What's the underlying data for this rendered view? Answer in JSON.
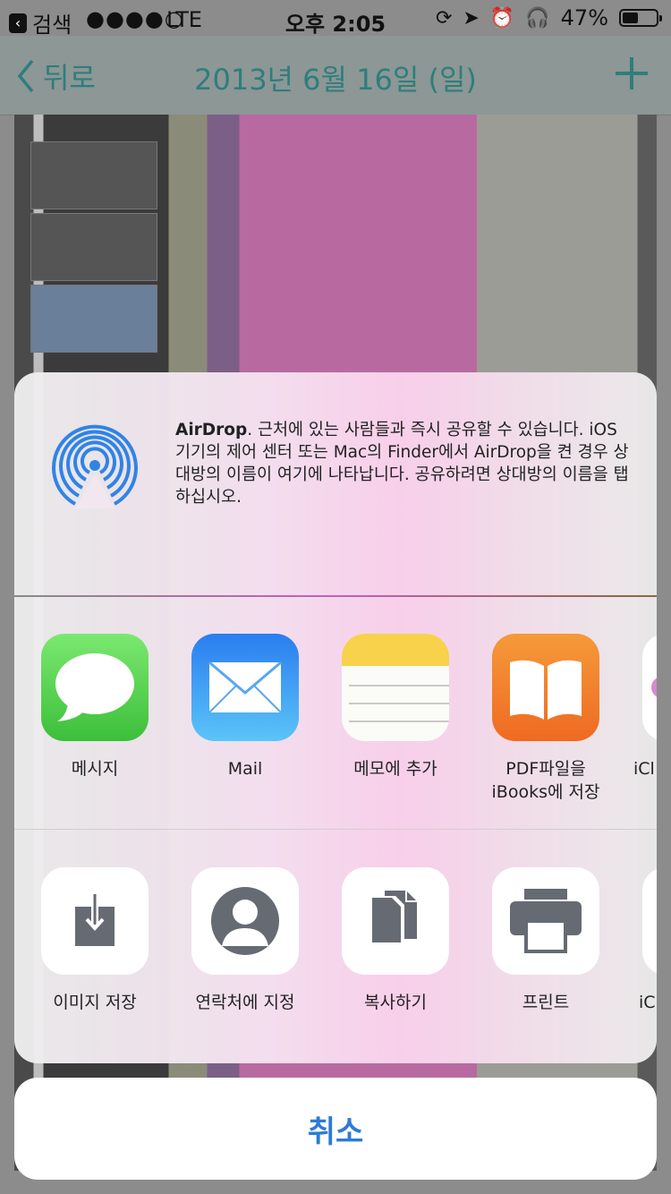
{
  "status_bar": {
    "back_app": "검색",
    "signal": "●●●●○",
    "carrier": "LTE",
    "time": "오후 2:05",
    "battery": "47%",
    "battery_level": 0.47
  },
  "nav": {
    "back_label": "뒤로",
    "title": "2013년 6월 16일 (일)"
  },
  "airdrop": {
    "title": "AirDrop",
    "text": ". 근처에 있는 사람들과 즉시 공유할 수 있습니다. iOS 기기의 제어 센터 또는 Mac의 Finder에서 AirDrop을 켠 경우 상대방의 이름이 여기에 나타납니다. 공유하려면 상대방의 이름을 탭하십시오."
  },
  "apps": [
    {
      "label": "메시지",
      "icon": "messages-icon"
    },
    {
      "label": "Mail",
      "icon": "mail-icon"
    },
    {
      "label": "메모에 추가",
      "icon": "notes-icon"
    },
    {
      "label": "PDF파일을\niBooks에 저장",
      "icon": "ibooks-icon"
    },
    {
      "label": "iCl",
      "icon": "icloud-icon"
    }
  ],
  "actions": [
    {
      "label": "이미지 저장",
      "icon": "save-image-icon"
    },
    {
      "label": "연락처에 지정",
      "icon": "contact-icon"
    },
    {
      "label": "복사하기",
      "icon": "copy-icon"
    },
    {
      "label": "프린트",
      "icon": "print-icon"
    },
    {
      "label": "iC",
      "icon": "icloud-action-icon"
    }
  ],
  "cancel_label": "취소",
  "colors": {
    "accent": "#2d7bd6",
    "nav_tint": "#2e7e7b",
    "messages_green": "#4cd964",
    "mail_blue": "#1e88f0",
    "ibooks_orange": "#f07a2a",
    "notes_yellow": "#f7d24a"
  }
}
